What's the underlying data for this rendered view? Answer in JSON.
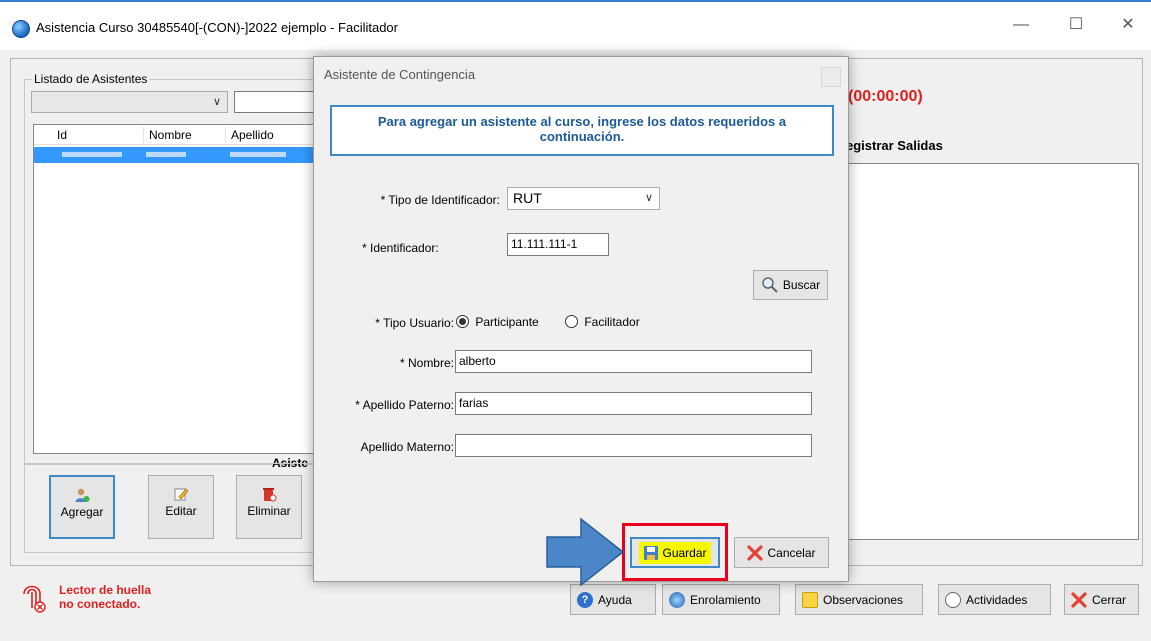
{
  "window": {
    "title": "Asistencia Curso 30485540[-(CON)-]2022 ejemplo - Facilitador",
    "minimize": "—",
    "maximize": "☐",
    "close": "✕"
  },
  "left_panel": {
    "group_label": "Listado de Asistentes",
    "combo_arrow": "∨",
    "columns": [
      "Id",
      "Nombre",
      "Apellido"
    ],
    "section_label": "Asiste",
    "buttons": {
      "agregar": "Agregar",
      "editar": "Editar",
      "eliminar": "Eliminar"
    }
  },
  "right_panel": {
    "timer": "(00:00:00)",
    "salidas_label": "egistrar Salidas"
  },
  "fingerprint": {
    "line1": "Lector de huella",
    "line2": "no conectado."
  },
  "bottom_buttons": {
    "ayuda": "Ayuda",
    "enrolamiento": "Enrolamiento",
    "observaciones": "Observaciones",
    "actividades": "Actividades",
    "cerrar": "Cerrar"
  },
  "dialog": {
    "title": "Asistente de Contingencia",
    "info_line1": "Para agregar un asistente al curso, ingrese los datos requeridos a",
    "info_line2": "continuación.",
    "tipo_identificador_label": "* Tipo de Identificador:",
    "tipo_identificador_value": "RUT",
    "identificador_label": "* Identificador:",
    "identificador_value": "11.111.111-1",
    "buscar": "Buscar",
    "tipo_usuario_label": "* Tipo Usuario:",
    "radio_participante": "Participante",
    "radio_facilitador": "Facilitador",
    "nombre_label": "* Nombre:",
    "nombre_value": "alberto",
    "apellido_paterno_label": "* Apellido Paterno:",
    "apellido_paterno_value": "farias",
    "apellido_materno_label": "Apellido Materno:",
    "apellido_materno_value": "",
    "guardar": "Guardar",
    "cancelar": "Cancelar"
  },
  "colors": {
    "accent_blue": "#3c8bc8",
    "highlight_red": "#e8001c",
    "highlight_yellow": "#f6f600",
    "timer_red": "#e02020",
    "selection_blue": "#3399ff",
    "arrow_blue": "#4a86c8"
  }
}
